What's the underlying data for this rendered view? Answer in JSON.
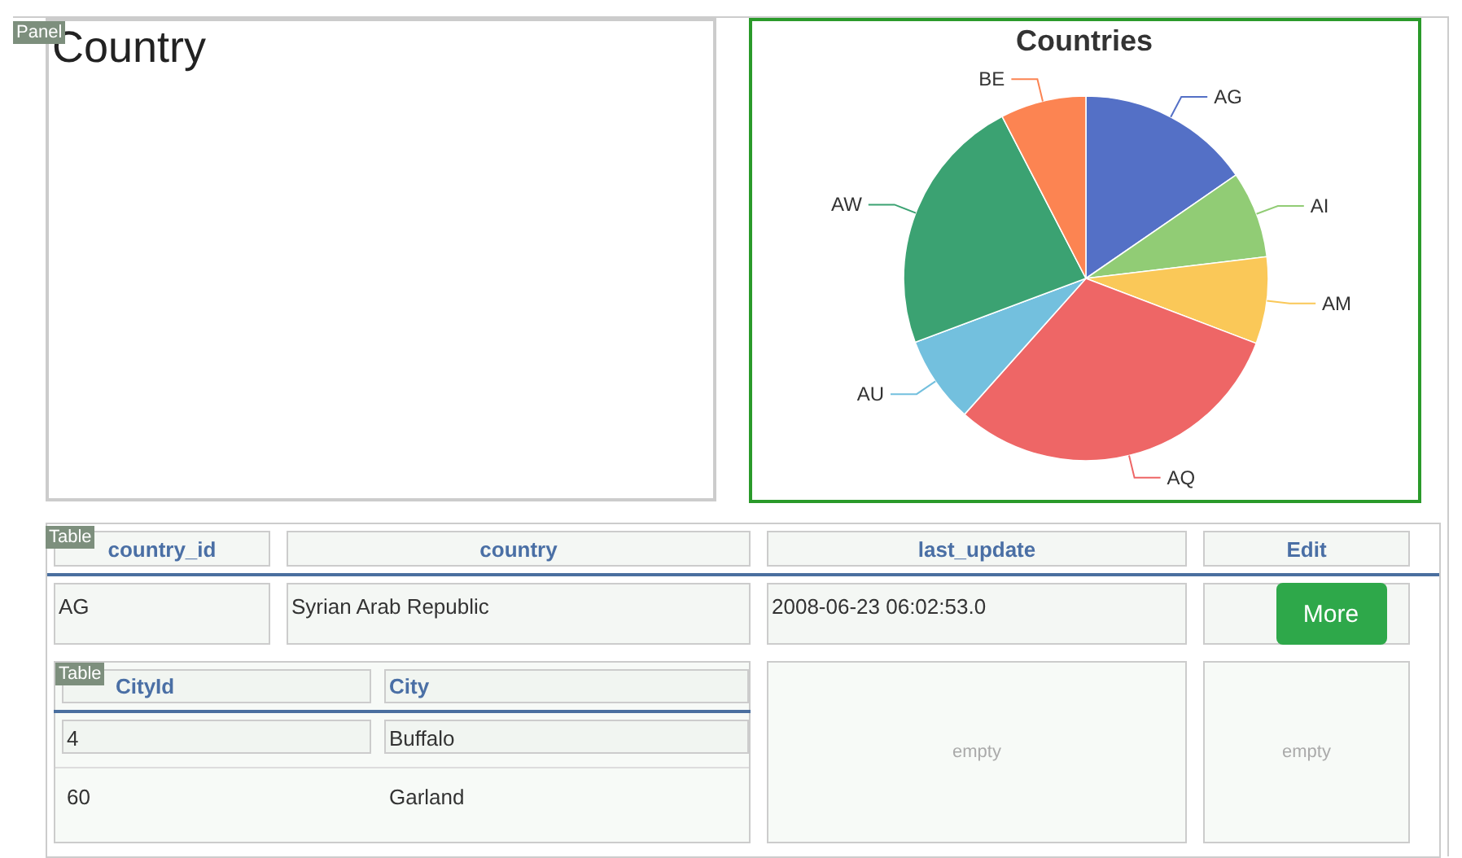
{
  "panel": {
    "badge": "Panel",
    "title": "Country"
  },
  "chart": {
    "chart_data": {
      "type": "pie",
      "title": "Countries",
      "categories": [
        "AG",
        "AI",
        "AM",
        "AQ",
        "AU",
        "AW",
        "BE"
      ],
      "values": [
        15.4,
        7.7,
        7.7,
        30.8,
        7.7,
        23.1,
        7.6
      ],
      "colors": [
        "#5470c6",
        "#91cc75",
        "#fac858",
        "#ee6666",
        "#73c0de",
        "#3ba272",
        "#fc8452"
      ]
    }
  },
  "table": {
    "badge": "Table",
    "columns": [
      "country_id",
      "country",
      "last_update",
      "Edit"
    ],
    "rows": [
      {
        "cells": [
          "AG",
          "Syrian Arab Republic",
          "2008-06-23 06:02:53.0"
        ],
        "button": "More"
      }
    ],
    "detail": {
      "badge": "Table",
      "columns": [
        "CityId",
        "City"
      ],
      "rows": [
        {
          "cells": [
            "4",
            "Buffalo"
          ],
          "selected": true
        },
        {
          "cells": [
            "60",
            "Garland"
          ],
          "selected": false
        }
      ],
      "empty_cells": [
        "empty",
        "empty"
      ]
    }
  }
}
